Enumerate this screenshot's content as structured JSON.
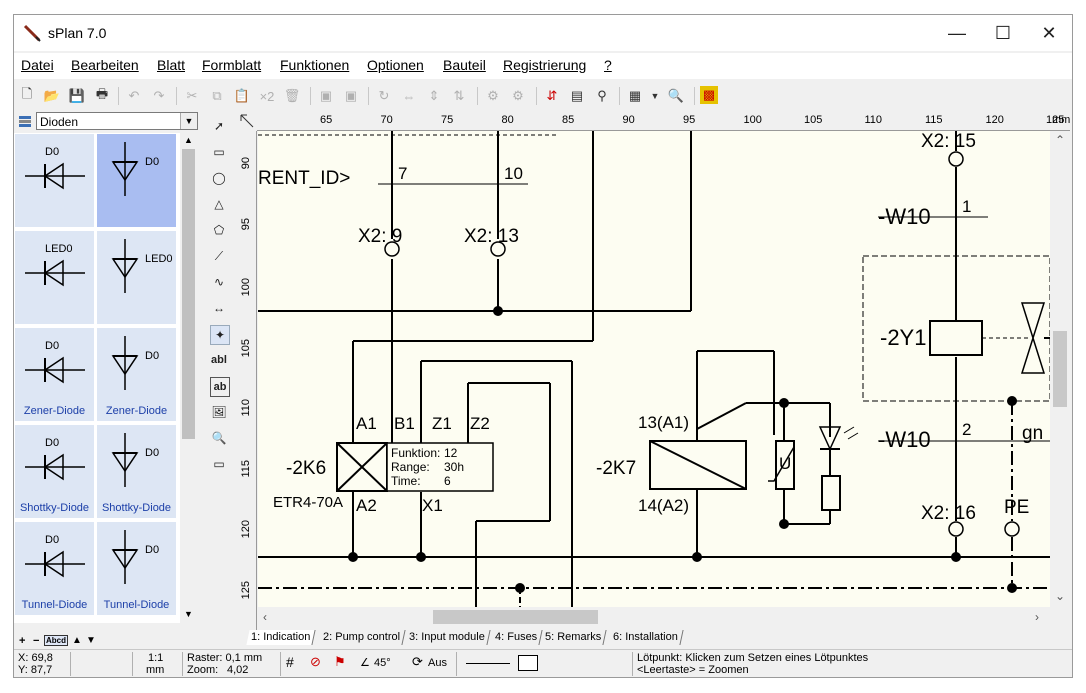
{
  "window": {
    "title": "sPlan 7.0"
  },
  "window_buttons": {
    "minimize": "—",
    "maximize": "☐",
    "close": "✕"
  },
  "menu": [
    "Datei",
    "Bearbeiten",
    "Blatt",
    "Formblatt",
    "Funktionen",
    "Optionen",
    "Bauteil",
    "Registrierung",
    "?"
  ],
  "toolbar": {
    "multiply_label": "×2"
  },
  "library": {
    "selected": "Dioden",
    "cells": [
      {
        "symbol_label": "D0",
        "name": ""
      },
      {
        "symbol_label": "D0",
        "name": ""
      },
      {
        "symbol_label": "LED0",
        "name": ""
      },
      {
        "symbol_label": "LED0",
        "name": ""
      },
      {
        "symbol_label": "D0",
        "name": "Zener-Diode"
      },
      {
        "symbol_label": "D0",
        "name": "Zener-Diode"
      },
      {
        "symbol_label": "D0",
        "name": "Shottky-Diode"
      },
      {
        "symbol_label": "D0",
        "name": "Shottky-Diode"
      },
      {
        "symbol_label": "D0",
        "name": "Tunnel-Diode"
      },
      {
        "symbol_label": "D0",
        "name": "Tunnel-Diode"
      }
    ],
    "bottom_buttons": [
      "+",
      "−",
      "Abcd",
      "▲",
      "▼"
    ]
  },
  "drawtools": {
    "text_label": "abl",
    "textbox_label": "ab"
  },
  "rulers": {
    "unit": "mm",
    "h_ticks": [
      "65",
      "70",
      "75",
      "80",
      "85",
      "90",
      "95",
      "100",
      "105",
      "110",
      "115",
      "120",
      "125"
    ],
    "v_ticks": [
      "90",
      "95",
      "100",
      "105",
      "110",
      "115",
      "120",
      "125"
    ]
  },
  "schematic": {
    "rent_id": "RENT_ID>",
    "wire_7": "7",
    "wire_10": "10",
    "x2_9": "X2: 9",
    "x2_13": "X2: 13",
    "x2_15": "X2: 15",
    "x2_16": "X2: 16",
    "w10_1_name": "-W10",
    "w10_1_num": "1",
    "w10_2_name": "-W10",
    "w10_2_num": "2",
    "gn": "gn",
    "pe": "PE",
    "y1": "-2Y1",
    "k6": "-2K6",
    "k6_type": "ETR4-70A",
    "k6_pins": [
      "A1",
      "B1",
      "Z1",
      "Z2",
      "A2",
      "X1"
    ],
    "k6_info": [
      {
        "key": "Funktion:",
        "val": "12"
      },
      {
        "key": "Range:",
        "val": "30h"
      },
      {
        "key": "Time:",
        "val": "6"
      }
    ],
    "k7": "-2K7",
    "k7_top": "13(A1)",
    "k7_bottom": "14(A2)",
    "varistor": "U"
  },
  "tabs": [
    "1: Indication",
    "2: Pump control",
    "3: Input module",
    "4: Fuses",
    "5: Remarks",
    "6: Installation"
  ],
  "status": {
    "x": "X: 69,8",
    "y": "Y: 87,7",
    "scale": "1:1",
    "scale_unit": "mm",
    "raster": "Raster: 0,1 mm",
    "zoom": "Zoom:",
    "zoom_val": "4,02",
    "angle": "45°",
    "aus": "Aus",
    "hint_1": "Lötpunkt: Klicken zum Setzen eines Lötpunktes",
    "hint_2": "<Leertaste> = Zoomen"
  }
}
